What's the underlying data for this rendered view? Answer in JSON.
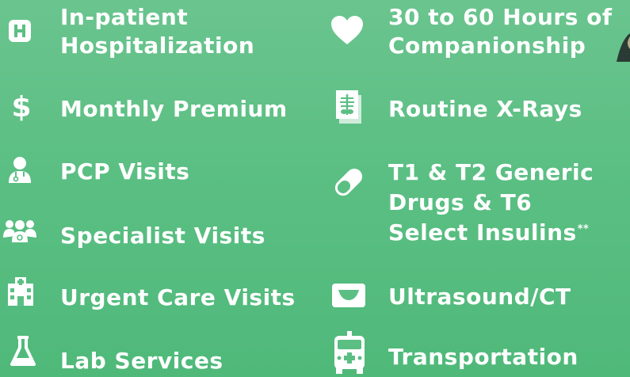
{
  "benefits_left": [
    {
      "icon": "hospital-icon",
      "lines": [
        "In-patient",
        "Hospitalization"
      ]
    },
    {
      "icon": "dollar-icon",
      "lines": [
        "Monthly Premium"
      ]
    },
    {
      "icon": "doctor-icon",
      "lines": [
        "PCP Visits"
      ]
    },
    {
      "icon": "group-doctors-icon",
      "lines": [
        "Specialist Visits"
      ]
    },
    {
      "icon": "clinic-building-icon",
      "lines": [
        "Urgent Care Visits"
      ]
    },
    {
      "icon": "flask-icon",
      "lines": [
        "Lab Services"
      ]
    }
  ],
  "benefits_right": [
    {
      "icon": "heart-icon",
      "lines": [
        "30 to 60 Hours of",
        "Companionship"
      ]
    },
    {
      "icon": "xray-icon",
      "lines": [
        "Routine X-Rays"
      ]
    },
    {
      "icon": "pill-icon",
      "lines": [
        "T1 & T2 Generic",
        "Drugs & T6",
        "Select Insulins"
      ],
      "footnote": "**"
    },
    {
      "icon": "ultrasound-icon",
      "lines": [
        "Ultrasound/CT"
      ]
    },
    {
      "icon": "ambulance-icon",
      "lines": [
        "Transportation"
      ]
    }
  ],
  "colors": {
    "background": "#5bbf83",
    "text": "#ffffff",
    "icon_fill": "#ffffff"
  }
}
